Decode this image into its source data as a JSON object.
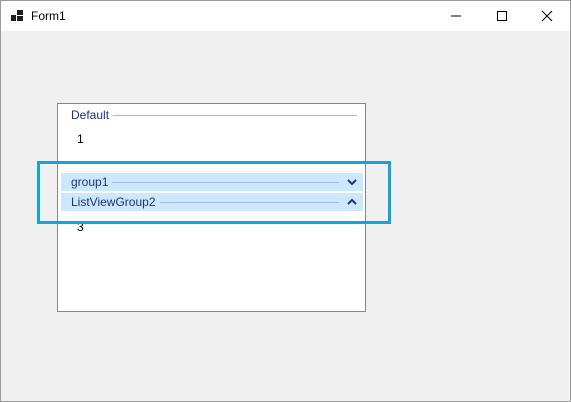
{
  "window": {
    "title": "Form1",
    "icon": "form-app-icon",
    "controls": [
      "minimize-icon",
      "maximize-icon",
      "close-icon"
    ]
  },
  "listview": {
    "groups": [
      {
        "header": "Default",
        "items": [
          "1"
        ],
        "collapsible": false
      },
      {
        "header": "group1",
        "items": [],
        "collapsed": true,
        "chevron": "chevron-down-icon"
      },
      {
        "header": "ListViewGroup2",
        "items": [
          "3"
        ],
        "collapsed": false,
        "chevron": "chevron-up-icon"
      }
    ]
  },
  "colors": {
    "group_header_text": "#1e3287",
    "group_line": "#9dbbe8",
    "selected_header_bg": "#cce8ff",
    "highlight_box": "#0ea5e0"
  }
}
